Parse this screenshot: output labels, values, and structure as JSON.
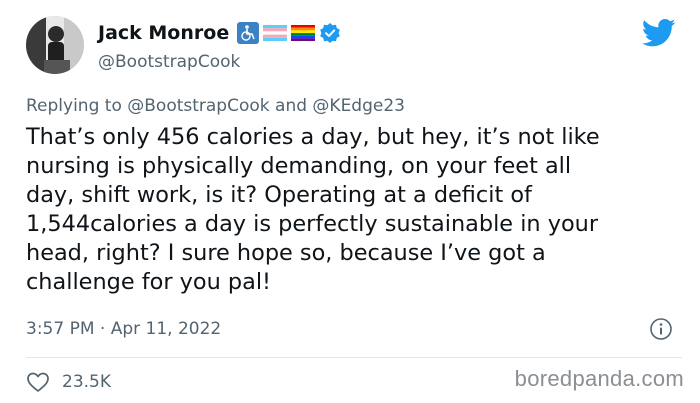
{
  "author": {
    "display_name": "Jack Monroe",
    "handle": "@BootstrapCook",
    "icons": [
      "wheelchair-emoji",
      "transgender-flag-emoji",
      "rainbow-flag-emoji",
      "verified-badge-icon"
    ]
  },
  "reply": {
    "prefix": "Replying to",
    "mention_1": "@BootstrapCook",
    "joiner": "and",
    "mention_2": "@KEdge23"
  },
  "tweet": {
    "text": "That’s only 456 calories a day, but hey, it’s not like\nnursing is physically demanding, on your feet all\nday, shift work, is it? Operating at a deficit of\n1,544calories a day is perfectly sustainable in your\nhead, right? I sure hope so, because I’ve got a\nchallenge for you pal!",
    "timestamp": "3:57 PM · Apr 11, 2022"
  },
  "engagement": {
    "likes": "23.5K"
  },
  "watermark": "boredpanda.com",
  "colors": {
    "twitter_blue": "#1d9bf0",
    "secondary_text": "#536471"
  }
}
